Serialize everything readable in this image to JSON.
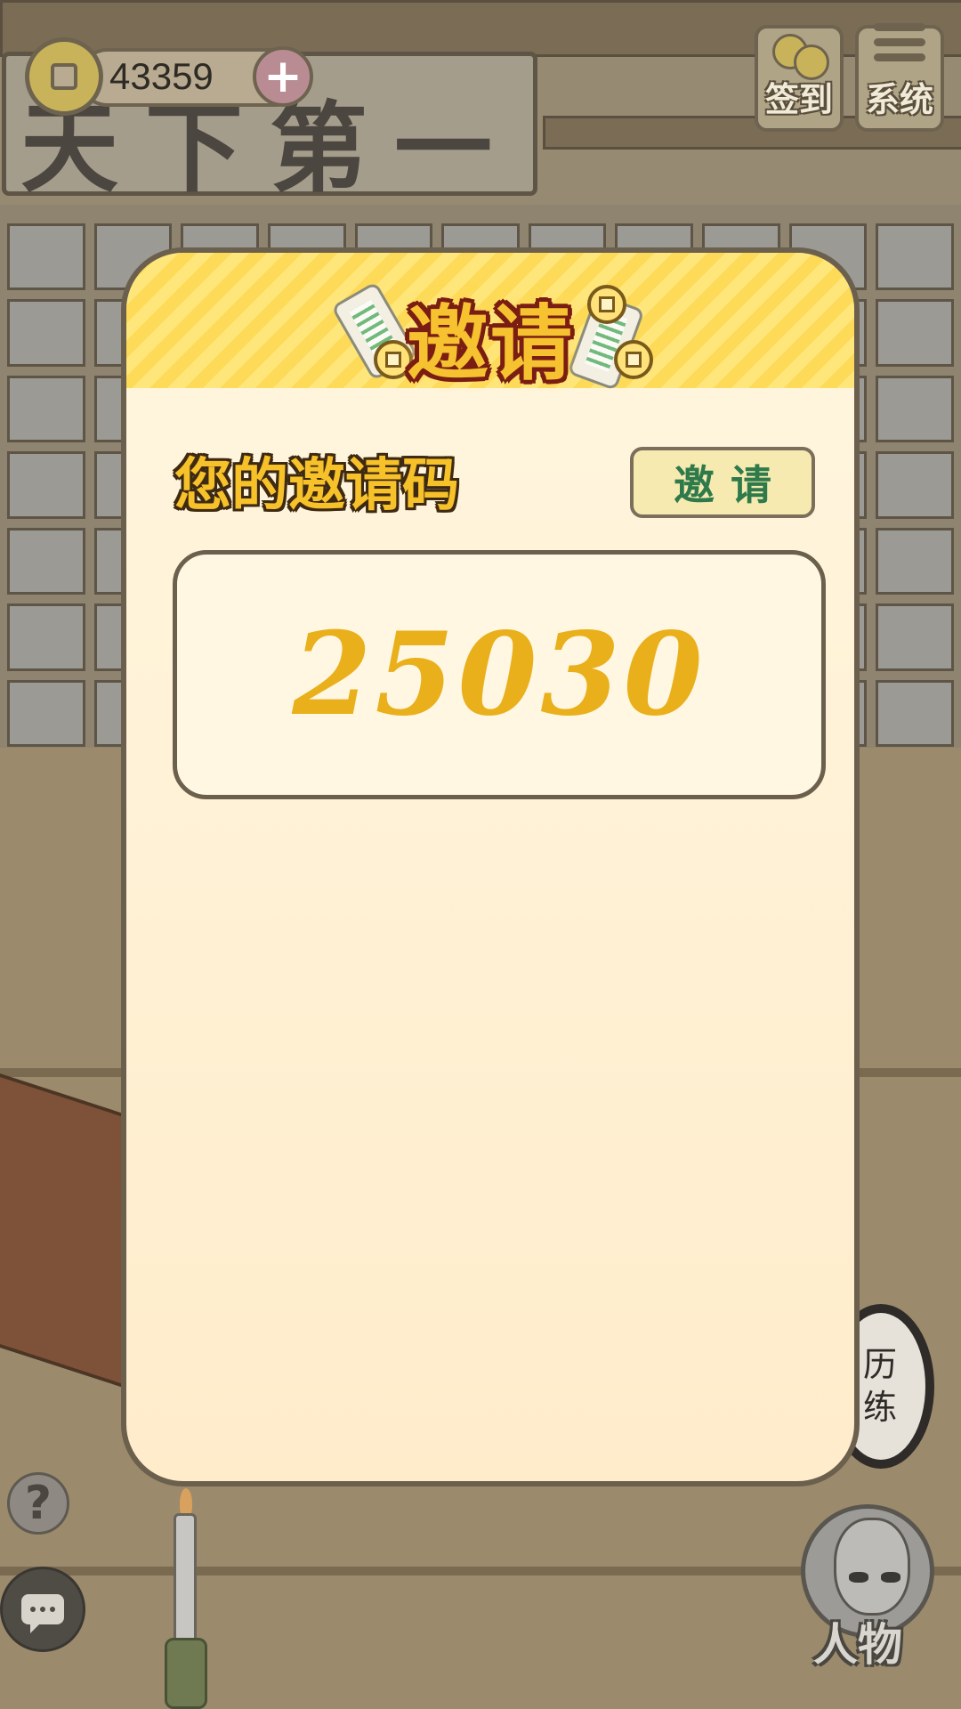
{
  "hud": {
    "coins": "43359",
    "plus_label": "+",
    "signin_label": "签到",
    "system_label": "系统",
    "help_label": "?"
  },
  "scene": {
    "sign_text": "天下第一",
    "training_label": "历练",
    "character_label": "人物"
  },
  "invite_panel": {
    "title": "邀请",
    "code_label": "您的邀请码",
    "invite_button_label": "邀请",
    "invite_code": "25030"
  }
}
